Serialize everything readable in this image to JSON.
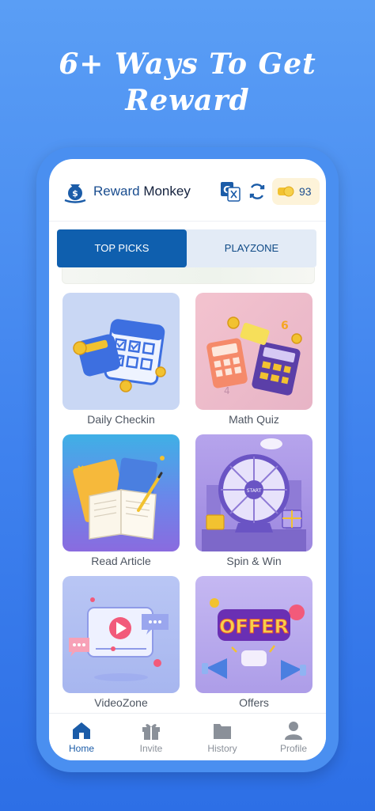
{
  "headline": {
    "line1": "6+ Ways To Get",
    "line2": "Reward"
  },
  "app": {
    "brand_part1": "Reward",
    "brand_part2": " Monkey",
    "coin_count": "93",
    "icons": {
      "logo": "money-bag-logo",
      "translate": "translate-icon",
      "refresh": "refresh-icon",
      "coins": "coins-icon"
    }
  },
  "tabs": [
    {
      "label": "TOP PICKS",
      "active": true
    },
    {
      "label": "PLAYZONE",
      "active": false
    }
  ],
  "cards": [
    {
      "label": "Daily Checkin",
      "icon": "calendar-wallet-illustration"
    },
    {
      "label": "Math Quiz",
      "icon": "calculators-illustration"
    },
    {
      "label": "Read Article",
      "icon": "books-illustration"
    },
    {
      "label": "Spin & Win",
      "icon": "wheel-illustration"
    },
    {
      "label": "VideoZone",
      "icon": "video-player-illustration"
    },
    {
      "label": "Offers",
      "icon": "offer-megaphone-illustration"
    }
  ],
  "nav": [
    {
      "label": "Home",
      "icon": "home-icon",
      "active": true
    },
    {
      "label": "Invite",
      "icon": "gift-icon",
      "active": false
    },
    {
      "label": "History",
      "icon": "folder-icon",
      "active": false
    },
    {
      "label": "Profile",
      "icon": "user-icon",
      "active": false
    }
  ],
  "colors": {
    "primary": "#0f5fae",
    "background": "#3f82ee",
    "active_nav": "#1b5ca8"
  }
}
